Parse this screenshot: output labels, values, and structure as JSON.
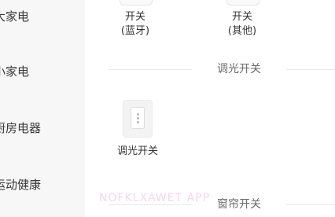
{
  "sidebar": {
    "items": [
      {
        "label": "大家电"
      },
      {
        "label": "小家电"
      },
      {
        "label": "厨房电器"
      },
      {
        "label": "运动健康"
      }
    ]
  },
  "devices_top": [
    {
      "line1": "开关",
      "line2": "(蓝牙)"
    },
    {
      "line1": "开关",
      "line2": "(其他)"
    }
  ],
  "sections": {
    "dimmer": {
      "title": "调光开关",
      "device_label": "调光开关",
      "icon": "dimmer-switch-icon"
    },
    "curtain": {
      "title": "窗帘开关"
    }
  },
  "watermark": "NOFKLXAWET APP",
  "colors": {
    "sidebar_bg": "#f7f7f8",
    "main_bg": "#ffffff",
    "text": "#333333",
    "divider": "#e8e8e8",
    "watermark": "#f4d7e8"
  }
}
